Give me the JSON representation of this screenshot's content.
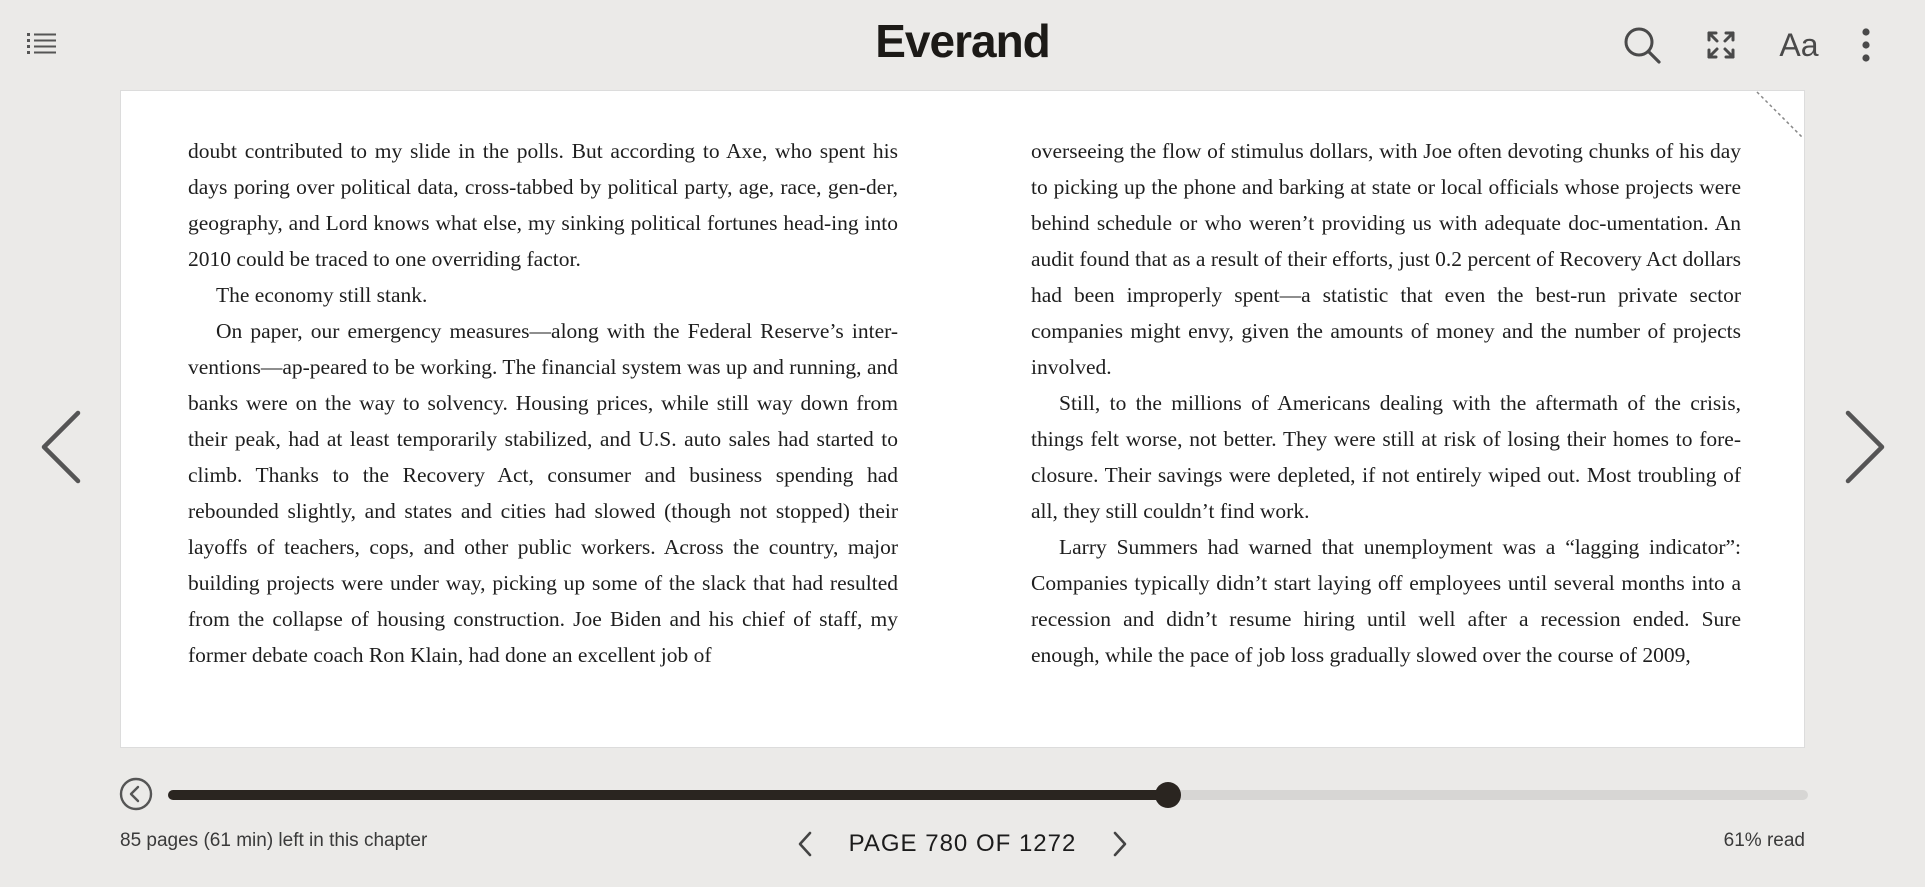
{
  "header": {
    "logo": "Everand",
    "font_label": "Aa",
    "icons": {
      "toc": "list-icon",
      "search": "search-icon",
      "fullscreen": "fullscreen-icon",
      "font": "font-settings-icon",
      "more": "more-vertical-icon"
    }
  },
  "book": {
    "left_column": [
      {
        "text": "doubt contributed to my slide in the polls. But according to Axe, who spent his days poring over political data, cross-tabbed by political party, age, race, gen-der, geography, and Lord knows what else, my sinking political fortunes head-ing into 2010 could be traced to one overriding factor.",
        "indent": false
      },
      {
        "text": "The economy still stank.",
        "indent": true
      },
      {
        "text": "On paper, our emergency measures—along with the Federal Reserve’s inter-ventions—ap-peared to be working. The financial system was up and running, and banks were on the way to solvency. Housing prices, while still way down from their peak, had at least temporarily stabilized, and U.S. auto sales had started to climb. Thanks to the Recovery Act, consumer and business spending had rebounded slightly, and states and cities had slowed (though not stopped) their layoffs of teachers, cops, and other public workers. Across the country, major building projects were under way, picking up some of the slack that had resulted from the collapse of housing construction. Joe Biden and his chief of staff, my former debate coach Ron Klain, had done an excellent job of",
        "indent": true
      }
    ],
    "right_column": [
      {
        "text": "overseeing the flow of stimulus dollars, with Joe often devoting chunks of his day to picking up the phone and barking at state or local officials whose projects were behind schedule or who weren’t providing us with adequate doc-umentation. An audit found that as a result of their efforts, just 0.2 percent of Recovery Act dollars had been improperly spent—a statistic that even the best-run private sector companies might envy, given the amounts of money and the number of projects involved.",
        "indent": false
      },
      {
        "text": "Still, to the millions of Americans dealing with the aftermath of the crisis, things felt worse, not better. They were still at risk of losing their homes to fore-closure. Their savings were depleted, if not entirely wiped out. Most troubling of all, they still couldn’t find work.",
        "indent": true
      },
      {
        "text": "Larry Summers had warned that unemployment was a “lagging indicator”: Companies typically didn’t start laying off employees until several months into a recession and didn’t resume hiring until well after a recession ended. Sure enough, while the pace of job loss gradually slowed over the course of 2009,",
        "indent": true
      }
    ]
  },
  "footer": {
    "chapter_left": "85 pages (61 min) left in this chapter",
    "page_indicator": "PAGE 780 OF 1272",
    "read_pct": "61% read",
    "progress_fraction": 0.61
  },
  "colors": {
    "background": "#ebeae8",
    "page": "#ffffff",
    "progress_fill": "#2a2520",
    "progress_track": "#d7d6d4"
  }
}
